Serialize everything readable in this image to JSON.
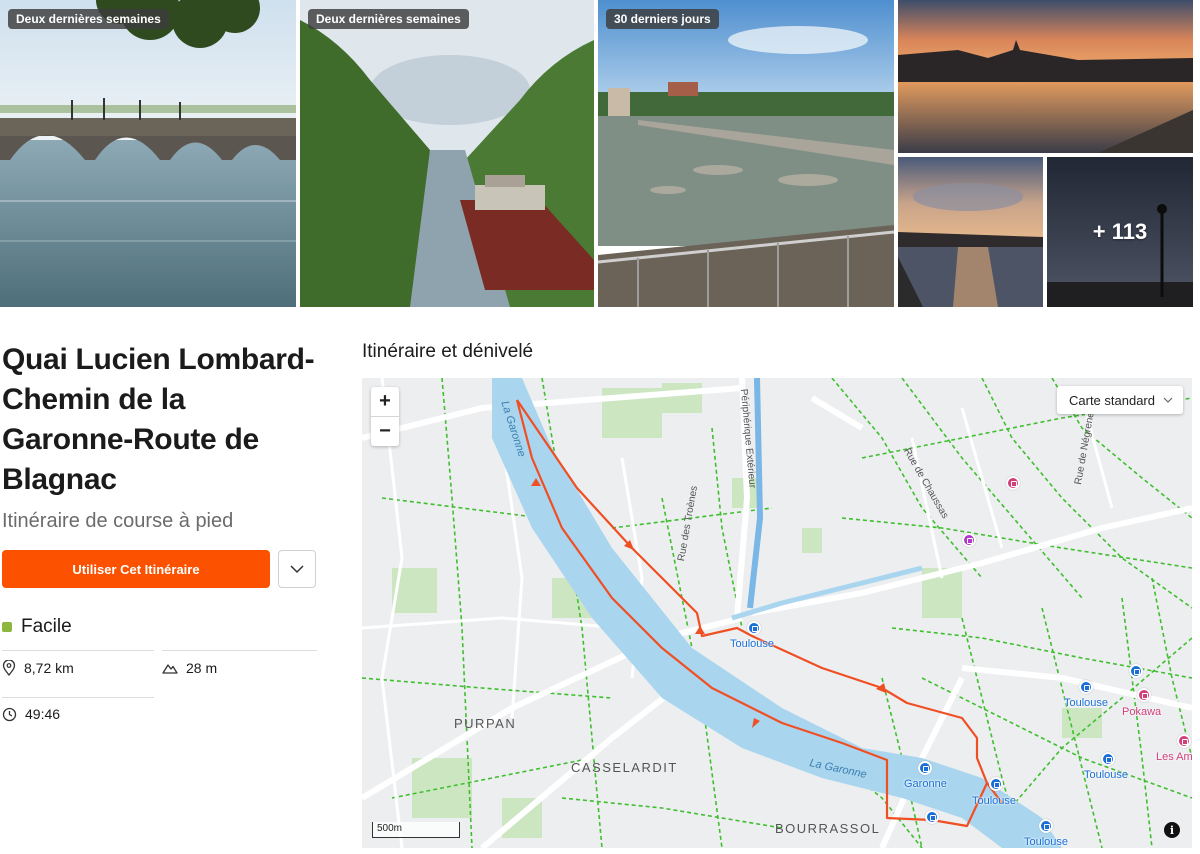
{
  "gallery": {
    "photos": [
      {
        "badge": "Deux dernières semaines",
        "scene": "bridge-river"
      },
      {
        "badge": "Deux dernières semaines",
        "scene": "canal-barge"
      },
      {
        "badge": "30 derniers jours",
        "scene": "river-weir"
      },
      {
        "badge": "",
        "scene": "sunset-river"
      },
      {
        "badge": "",
        "scene": "sunset-bridge"
      },
      {
        "badge": "",
        "scene": "evening-lamp"
      }
    ],
    "more_label": "+ 113"
  },
  "route": {
    "title": "Quai Lucien Lombard-Chemin de la Garonne-Route de Blagnac",
    "subtitle": "Itinéraire de course à pied",
    "cta_label": "Utiliser Cet Itinéraire",
    "difficulty": "Facile",
    "difficulty_color": "#8cb63c",
    "distance": "8,72 km",
    "elevation": "28 m",
    "duration": "49:46"
  },
  "map": {
    "heading": "Itinéraire et dénivelé",
    "layer_select": "Carte standard",
    "zoom_in": "+",
    "zoom_out": "−",
    "scale": "500m",
    "info": "i",
    "labels": {
      "river_north": "La Garonne",
      "river_south": "La Garonne",
      "purpan": "PURPAN",
      "casselardit": "CASSELARDIT",
      "bourrassol": "BOURRASSOL",
      "rue_troenes": "Rue des Troènes",
      "periph": "Périphérique Extérieur",
      "rue_chaussas": "Rue de Chaussas",
      "rue_negreneys": "Rue de Négreneys",
      "toulouse_1": "Toulouse",
      "toulouse_2": "Toulouse",
      "toulouse_3": "Toulouse",
      "toulouse_4": "Toulouse",
      "toulouse_5": "Toulouse",
      "garonne_stop": "Garonne",
      "pokawa": "Pokawa",
      "les_amer": "Les Amer"
    },
    "route_color": "#f04e23",
    "river_color": "#a9d6ee",
    "path_color": "#3fbf2e"
  }
}
